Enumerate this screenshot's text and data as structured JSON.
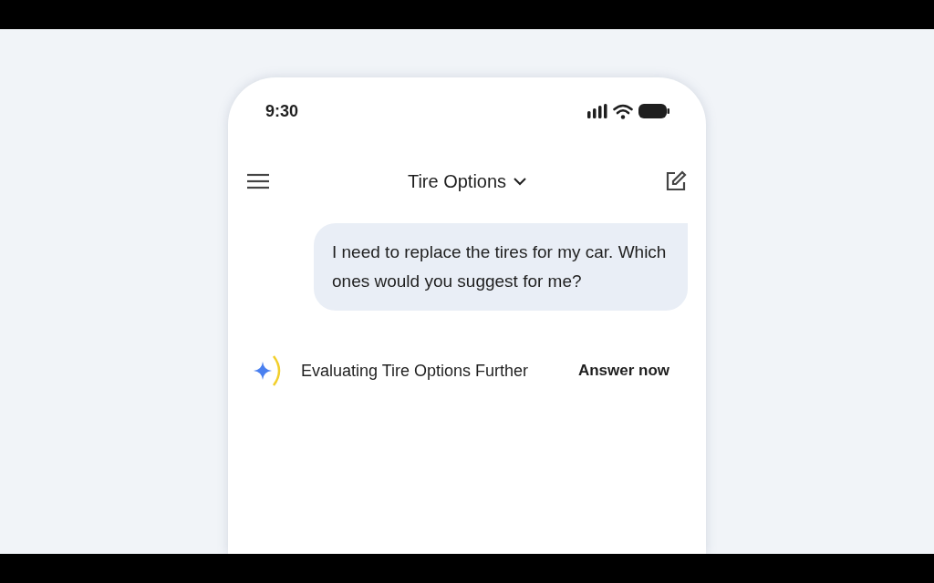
{
  "status_bar": {
    "time": "9:30"
  },
  "header": {
    "title": "Tire Options"
  },
  "messages": [
    {
      "kind": "user",
      "text": "I need to replace the tires for my car. Which ones would you suggest for me?"
    },
    {
      "kind": "thinking",
      "text": "Evaluating Tire Options Further",
      "action": "Answer now"
    }
  ]
}
